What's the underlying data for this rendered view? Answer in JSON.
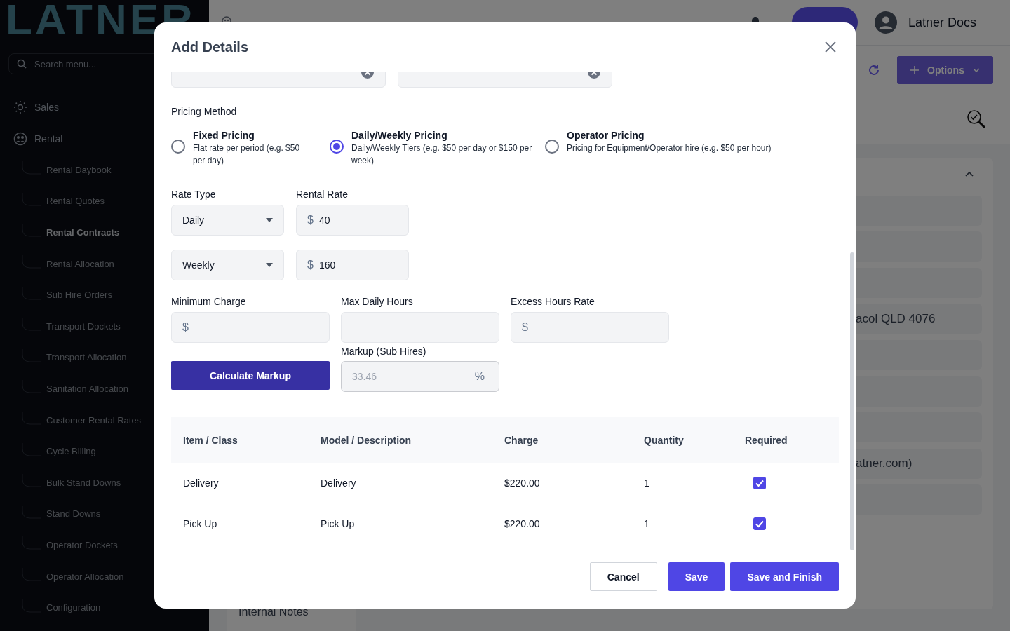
{
  "sidebar": {
    "logo": "LATNER",
    "search": {
      "placeholder": "Search menu..."
    },
    "items": [
      {
        "label": "Sales",
        "kind": "sales"
      },
      {
        "label": "Rental",
        "kind": "rental",
        "children": [
          {
            "label": "Rental Daybook",
            "selected": false
          },
          {
            "label": "Rental Quotes",
            "selected": false
          },
          {
            "label": "Rental Contracts",
            "selected": true
          },
          {
            "label": "Rental Allocation",
            "selected": false
          },
          {
            "label": "Sub Hire Orders",
            "selected": false
          },
          {
            "label": "Transport Dockets",
            "selected": false
          },
          {
            "label": "Transport Allocation",
            "selected": false
          },
          {
            "label": "Sanitation Allocation",
            "selected": false
          },
          {
            "label": "Customer Rental Rates",
            "selected": false
          },
          {
            "label": "Cycle Billing",
            "selected": false
          },
          {
            "label": "Bulk Stand Downs",
            "selected": false
          },
          {
            "label": "Stand Downs",
            "selected": false
          },
          {
            "label": "Operator Dockets",
            "selected": false
          },
          {
            "label": "Operator Allocation",
            "selected": false
          },
          {
            "label": "Configuration",
            "selected": false
          }
        ]
      }
    ]
  },
  "topbar": {
    "user": "Latner Docs"
  },
  "toolbar": {
    "options_button": "Options"
  },
  "details_panel": {
    "rows": [
      {
        "kind": "blank"
      },
      {
        "kind": "blank"
      },
      {
        "kind": "blank"
      },
      {
        "kind": "text",
        "text": "acol QLD 4076"
      },
      {
        "kind": "blank"
      },
      {
        "kind": "blank"
      },
      {
        "kind": "blank"
      },
      {
        "kind": "text",
        "text": "atner.com)"
      },
      {
        "kind": "blank"
      }
    ]
  },
  "notes_label": "Internal Notes",
  "modal": {
    "title": "Add Details",
    "chips": [
      {
        "clearable": true
      },
      {
        "clearable": true
      }
    ],
    "pricing_method": {
      "label": "Pricing Method",
      "options": [
        {
          "title": "Fixed Pricing",
          "description": "Flat rate per period (e.g. $50 per day)",
          "selected": false
        },
        {
          "title": "Daily/Weekly Pricing",
          "description": "Daily/Weekly Tiers (e.g. $50 per day or $150 per week)",
          "selected": true
        },
        {
          "title": "Operator Pricing",
          "description": "Pricing for Equipment/Operator hire (e.g. $50 per hour)",
          "selected": false
        }
      ]
    },
    "rate_type_label": "Rate Type",
    "rental_rate_label": "Rental Rate",
    "rates": [
      {
        "type": "Daily",
        "prefix": "$",
        "value": "40"
      },
      {
        "type": "Weekly",
        "prefix": "$",
        "value": "160"
      }
    ],
    "minimum_charge": {
      "label": "Minimum Charge",
      "prefix": "$"
    },
    "max_daily_hours": {
      "label": "Max Daily Hours"
    },
    "excess_hours_rate": {
      "label": "Excess Hours Rate",
      "prefix": "$"
    },
    "calculate_button": "Calculate Markup",
    "markup": {
      "label": "Markup (Sub Hires)",
      "value": "33.46",
      "suffix": "%",
      "disabled": true
    },
    "table": {
      "columns": [
        "Item / Class",
        "Model / Description",
        "Charge",
        "Quantity",
        "Required"
      ],
      "rows": [
        {
          "item": "Delivery",
          "model": "Delivery",
          "charge": "$220.00",
          "quantity": "1",
          "required": true
        },
        {
          "item": "Pick Up",
          "model": "Pick Up",
          "charge": "$220.00",
          "quantity": "1",
          "required": true
        }
      ]
    },
    "buttons": [
      {
        "label": "Cancel",
        "kind": "secondary"
      },
      {
        "label": "Save",
        "kind": "primary"
      },
      {
        "label": "Save and Finish",
        "kind": "primary"
      }
    ]
  }
}
